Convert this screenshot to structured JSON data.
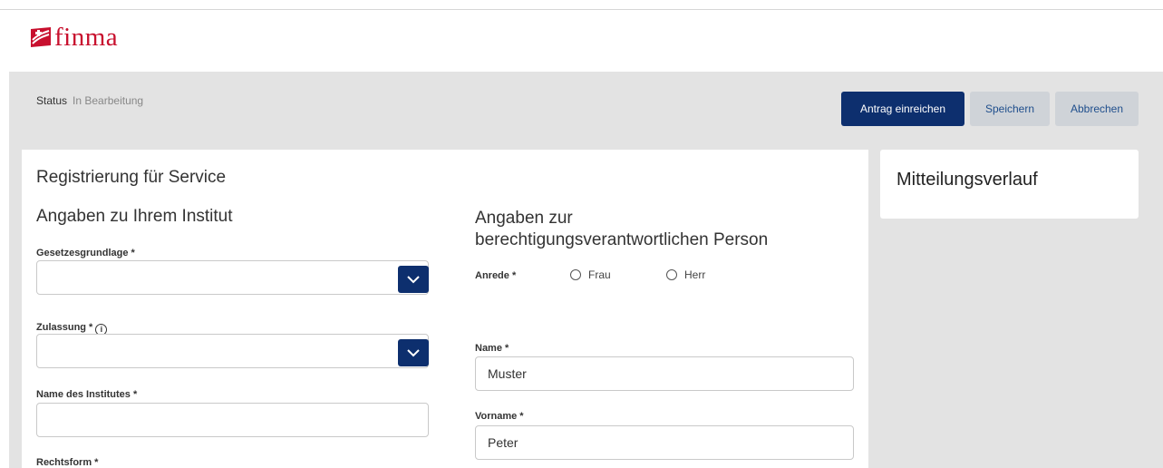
{
  "logo": {
    "text": "finma"
  },
  "status": {
    "label": "Status",
    "value": "In Bearbeitung"
  },
  "actions": {
    "submit_label": "Antrag einreichen",
    "save_label": "Speichern",
    "cancel_label": "Abbrechen"
  },
  "form": {
    "title": "Registrierung für Service",
    "institute_section": {
      "heading": "Angaben zu Ihrem Institut",
      "legal_basis_label": "Gesetzesgrundlage *",
      "legal_basis_value": "",
      "license_label": "Zulassung *",
      "license_value": "",
      "institute_name_label": "Name des Institutes *",
      "institute_name_value": "",
      "legal_form_label": "Rechtsform *"
    },
    "person_section": {
      "heading_line1": "Angaben zur",
      "heading_line2": "berechtigungsverantwortlichen Person",
      "salutation_label": "Anrede *",
      "salutation_options": [
        "Frau",
        "Herr"
      ],
      "name_label": "Name *",
      "name_value": "Muster",
      "firstname_label": "Vorname *",
      "firstname_value": "Peter"
    }
  },
  "sidebar": {
    "title": "Mitteilungsverlauf"
  },
  "colors": {
    "primary": "#0d2f6e",
    "brand_red": "#c8102e",
    "gray_bg": "#e3e3e3"
  }
}
